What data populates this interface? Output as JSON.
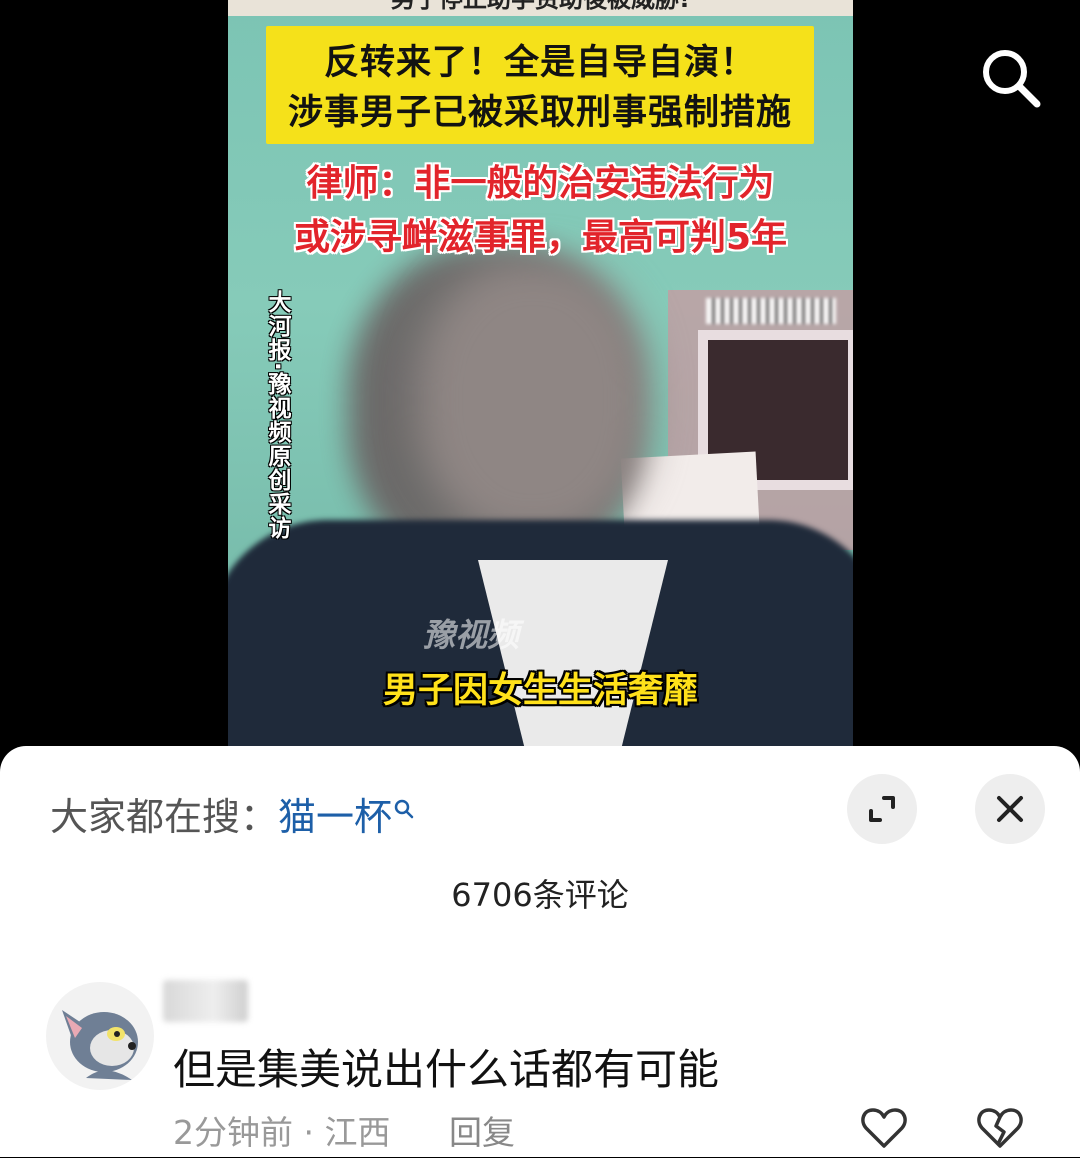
{
  "video": {
    "top_ribbon": "男子停止助学资助後被威胁!",
    "headline_lines": [
      "反转来了！全是自导自演！",
      "涉事男子已被采取刑事强制措施"
    ],
    "lawyer_lines": [
      "律师：非一般的治安违法行为",
      "或涉寻衅滋事罪，最高可判5年"
    ],
    "vertical_credit": "大河报·豫视频原创采访",
    "watermark": "豫视频",
    "subtitle": "男子因女生生活奢靡"
  },
  "comment_sheet": {
    "hot_search_label": "大家都在搜：",
    "hot_search_keyword": "猫一杯",
    "comment_count": "6706条评论",
    "comments": [
      {
        "text": "但是集美说出什么话都有可能",
        "time": "2分钟前",
        "location": "江西",
        "reply_label": "回复"
      }
    ]
  },
  "icons": [
    "search-icon",
    "expand-icon",
    "close-icon",
    "like-icon",
    "dislike-icon",
    "avatar"
  ],
  "colors": {
    "keyword": "#1d5fa8",
    "headline_bg": "#f5e11a",
    "lawyer_text": "#e2242b",
    "subtitle_text": "#ffe11a"
  }
}
